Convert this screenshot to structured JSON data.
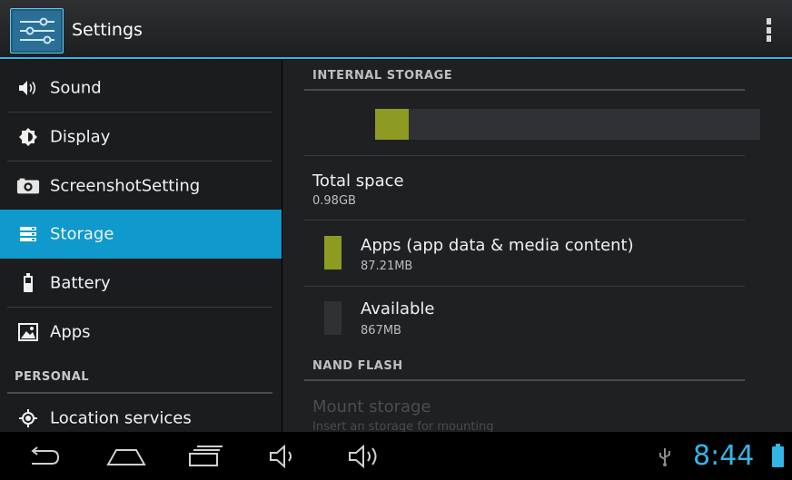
{
  "app": {
    "title": "Settings",
    "icon": "settings-sliders-icon"
  },
  "action_bar": {
    "overflow_icon": "overflow-menu-icon"
  },
  "colors": {
    "accent": "#33b5e5",
    "selected": "#0f99cc",
    "apps_usage": "#8e9b22",
    "available": "#303134"
  },
  "sidebar": {
    "items": [
      {
        "label": "Sound",
        "icon": "speaker-icon",
        "selected": false
      },
      {
        "label": "Display",
        "icon": "brightness-icon",
        "selected": false
      },
      {
        "label": "ScreenshotSetting",
        "icon": "camera-icon",
        "selected": false
      },
      {
        "label": "Storage",
        "icon": "storage-icon",
        "selected": true
      },
      {
        "label": "Battery",
        "icon": "battery-icon",
        "selected": false
      },
      {
        "label": "Apps",
        "icon": "apps-icon",
        "selected": false
      }
    ],
    "section_header": "PERSONAL",
    "personal_items": [
      {
        "label": "Location services",
        "icon": "location-icon"
      }
    ]
  },
  "storage": {
    "internal_header": "INTERNAL STORAGE",
    "usage_fraction": 0.087,
    "total": {
      "title": "Total space",
      "value": "0.98GB"
    },
    "apps": {
      "title": "Apps (app data & media content)",
      "value": "87.21MB"
    },
    "available": {
      "title": "Available",
      "value": "867MB"
    },
    "nand_header": "NAND FLASH",
    "mount": {
      "title": "Mount storage",
      "subtitle": "Insert an storage for mounting"
    }
  },
  "system_bar": {
    "back_icon": "back-icon",
    "home_icon": "home-icon",
    "recents_icon": "recent-apps-icon",
    "volume_down_icon": "volume-down-icon",
    "volume_up_icon": "volume-up-icon",
    "usb_icon": "usb-icon",
    "time": "8:44",
    "battery_icon": "battery-status-icon"
  }
}
